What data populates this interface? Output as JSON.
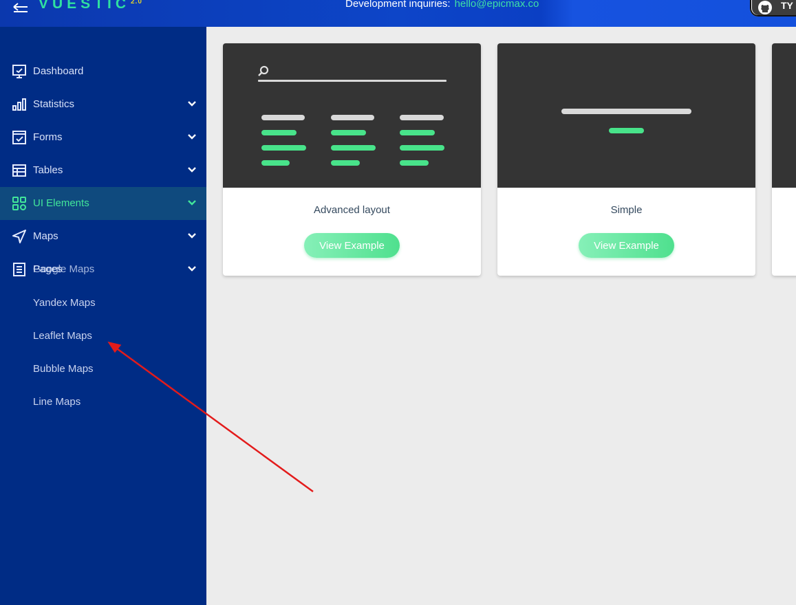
{
  "header": {
    "logo": "VUESTIC",
    "logo_version": "2.0",
    "inquiry_label": "Development inquiries:",
    "inquiry_email": "hello@epicmax.co",
    "github_label": "TY"
  },
  "sidebar": {
    "items": [
      {
        "label": "Dashboard",
        "icon": "dashboard-icon"
      },
      {
        "label": "Statistics",
        "icon": "statistics-icon"
      },
      {
        "label": "Forms",
        "icon": "forms-icon"
      },
      {
        "label": "Tables",
        "icon": "tables-icon"
      },
      {
        "label": "UI Elements",
        "icon": "ui-elements-icon"
      },
      {
        "label": "Maps",
        "icon": "maps-icon"
      },
      {
        "label": "Pages",
        "icon": "pages-icon"
      }
    ],
    "overlap_label": "Google Maps",
    "sub_items": [
      "Yandex Maps",
      "Leaflet Maps",
      "Bubble Maps",
      "Line Maps"
    ]
  },
  "cards": [
    {
      "title": "Advanced layout",
      "button": "View Example"
    },
    {
      "title": "Simple",
      "button": "View Example"
    }
  ],
  "colors": {
    "sidebar_bg": "#002c85",
    "accent_green": "#42e69a",
    "annotation_arrow": "#e31b1b"
  }
}
